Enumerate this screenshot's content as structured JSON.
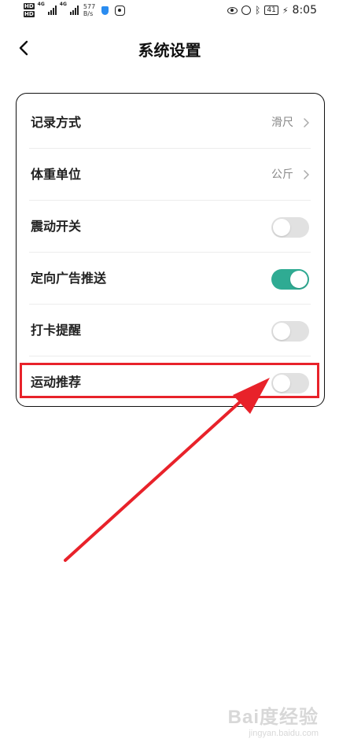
{
  "status_bar": {
    "hd": "HD",
    "network": "4G",
    "speed_value": "577",
    "speed_unit": "B/s",
    "battery": "41",
    "time": "8:05"
  },
  "header": {
    "title": "系统设置"
  },
  "settings": {
    "rows": [
      {
        "label": "记录方式",
        "value": "滑尺"
      },
      {
        "label": "体重单位",
        "value": "公斤"
      },
      {
        "label": "震动开关",
        "toggle_on": false
      },
      {
        "label": "定向广告推送",
        "toggle_on": true
      },
      {
        "label": "打卡提醒",
        "toggle_on": false
      },
      {
        "label": "运动推荐",
        "toggle_on": false
      }
    ]
  },
  "colors": {
    "toggle_on": "#2fab93",
    "toggle_off": "#e1e1e1",
    "annotation_red": "#e8222a"
  },
  "watermark": {
    "main": "Bai度经验",
    "sub": "jingyan.baidu.com"
  }
}
